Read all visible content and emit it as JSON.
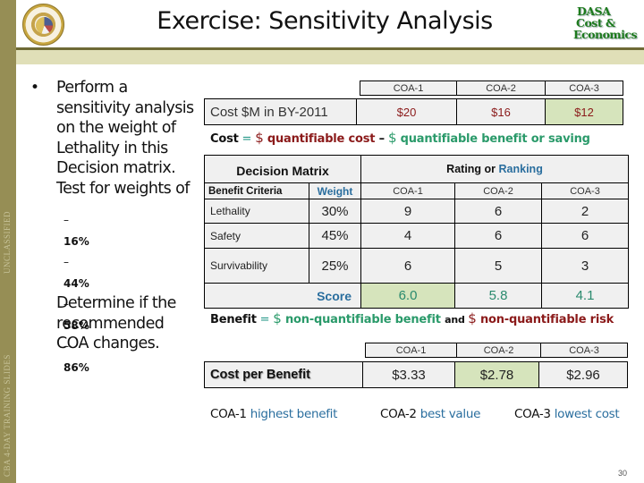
{
  "slide": {
    "title": "Exercise: Sensitivity Analysis",
    "logo_lines": [
      "DASA",
      "Cost &",
      "Economics"
    ],
    "side_labels": {
      "top": "UNCLASSIFIED",
      "bottom": "CBA 4-DAY TRAINING SLIDES"
    },
    "page_number": "30",
    "colors": {
      "side_bar": "#968e55",
      "header_line": "#6e6a35",
      "header_band": "#e0dfb8",
      "highlight": "#d6e4bc",
      "cost_red": "#8b1a1a",
      "benefit_green": "#2a9a6a",
      "accent_blue": "#2a6e9e"
    }
  },
  "instructions": {
    "bullet_lines": [
      "Perform a",
      "sensitivity analysis",
      "on the weight of",
      "Lethality in this",
      "Decision matrix.",
      "Test for weights of"
    ],
    "weights": [
      "16%",
      "44%",
      "58%",
      "86%"
    ],
    "dash": "–",
    "closing_lines": [
      "Determine if the",
      "recommended",
      "COA changes."
    ]
  },
  "cost_table": {
    "headers": [
      "COA-1",
      "COA-2",
      "COA-3"
    ],
    "row_label": "Cost $M in BY-2011",
    "values": [
      "$20",
      "$16",
      "$12"
    ],
    "highlight_index": 2
  },
  "cost_formula": {
    "term": "Cost",
    "eq": " = ",
    "dollar": "$",
    "part1": " quantifiable cost ",
    "minus": "–",
    "part2": " quantifiable benefit or saving"
  },
  "decision_matrix": {
    "title": "Decision Matrix",
    "rating_title_a": "Rating or ",
    "rating_title_b": "Ranking",
    "criteria_header": "Benefit Criteria",
    "weight_header": "Weight",
    "coa_headers": [
      "COA-1",
      "COA-2",
      "COA-3"
    ],
    "rows": [
      {
        "criterion": "Lethality",
        "weight": "30%",
        "ratings": [
          "9",
          "6",
          "2"
        ]
      },
      {
        "criterion": "Safety",
        "weight": "45%",
        "ratings": [
          "4",
          "6",
          "6"
        ]
      },
      {
        "criterion": "Survivability",
        "weight": "25%",
        "ratings": [
          "6",
          "5",
          "3"
        ]
      }
    ],
    "score_label": "Score",
    "scores": [
      "6.0",
      "5.8",
      "4.1"
    ],
    "highlight_index": 0
  },
  "benefit_formula": {
    "term": "Benefit",
    "eq": " = ",
    "dollar": "$",
    "part1": " non-quantifiable benefit ",
    "and": "and ",
    "part2": " non-quantifiable risk"
  },
  "cost_per_benefit": {
    "headers": [
      "COA-1",
      "COA-2",
      "COA-3"
    ],
    "row_label": "Cost per Benefit",
    "values": [
      "$3.33",
      "$2.78",
      "$2.96"
    ],
    "highlight_index": 1
  },
  "verdicts": [
    {
      "coa": "COA-1",
      "verdict": "highest benefit"
    },
    {
      "coa": "COA-2",
      "verdict": "best value"
    },
    {
      "coa": "COA-3",
      "verdict": "lowest cost"
    }
  ]
}
